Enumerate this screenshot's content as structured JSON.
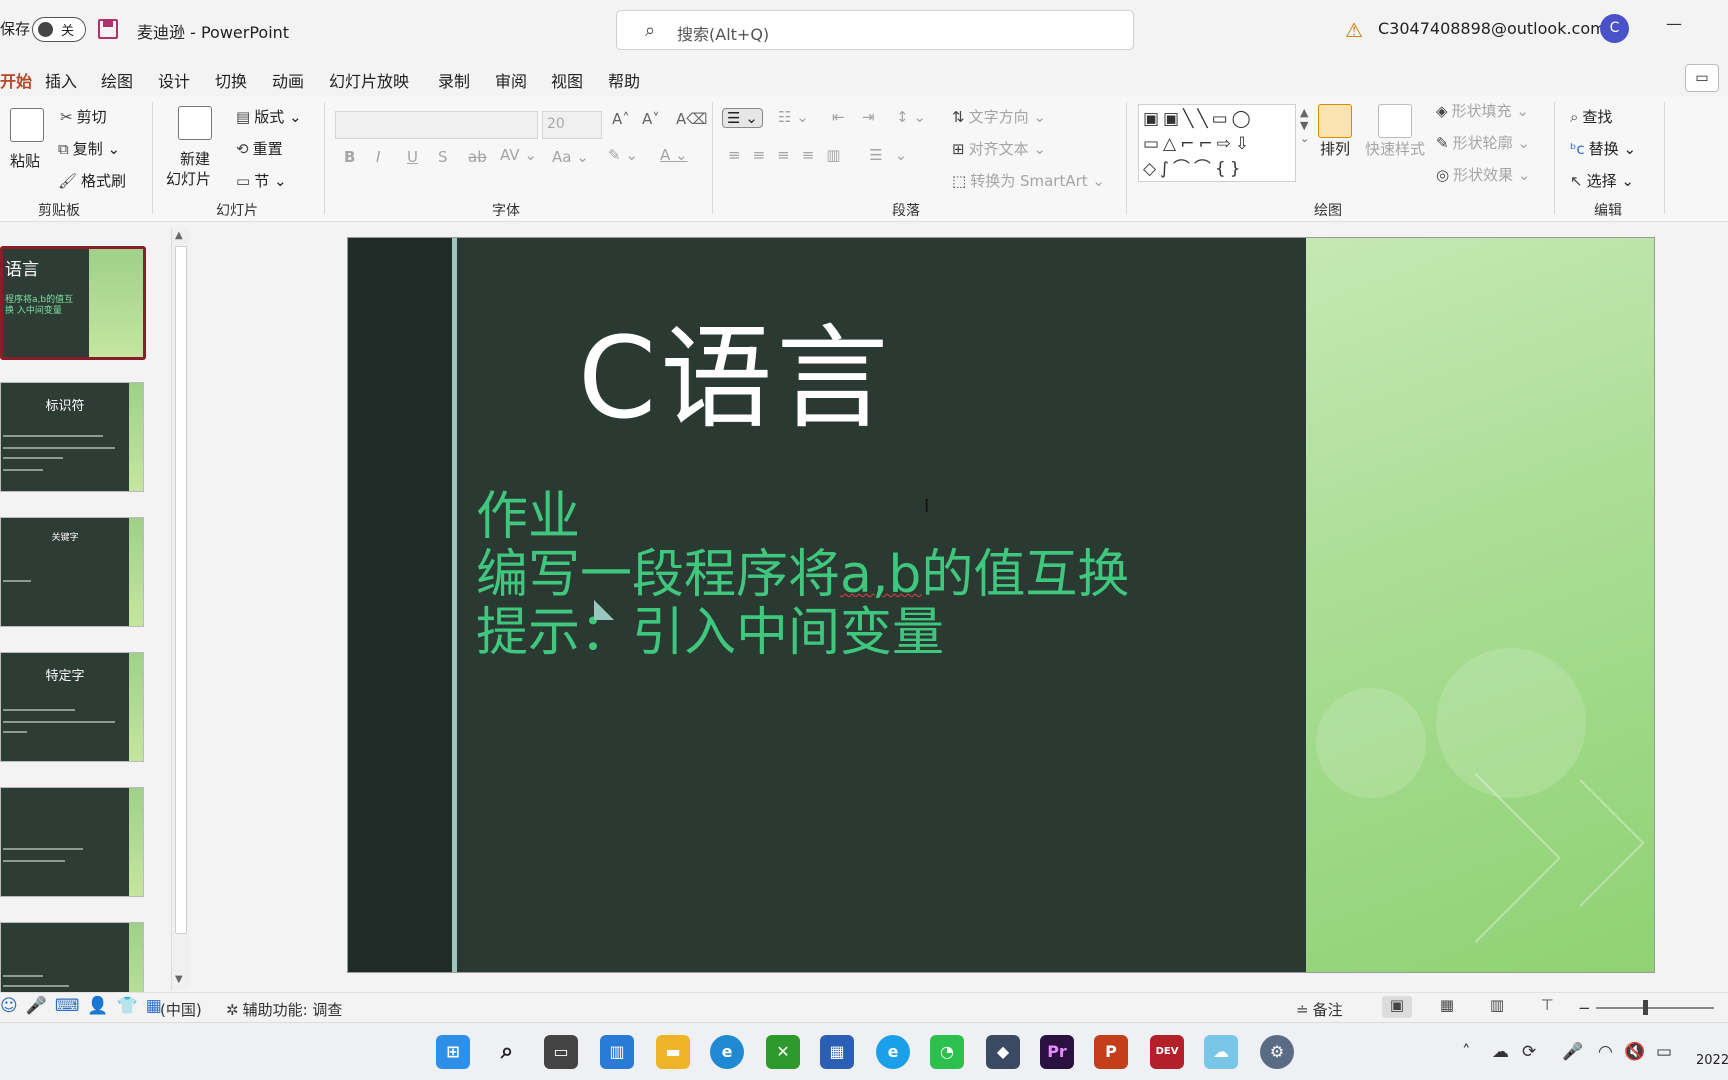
{
  "titlebar": {
    "autosave_label": "保存",
    "toggle_state": "关",
    "doc_title": "麦迪逊  -  PowerPoint",
    "search_placeholder": "搜索(Alt+Q)",
    "account": "C3047408898@outlook.com",
    "avatar_letter": "C"
  },
  "tabs": [
    "开始",
    "插入",
    "绘图",
    "设计",
    "切换",
    "动画",
    "幻灯片放映",
    "录制",
    "审阅",
    "视图",
    "帮助"
  ],
  "ribbon": {
    "clipboard": {
      "paste": "粘贴",
      "cut": "剪切",
      "copy": "复制",
      "format_painter": "格式刷",
      "label": "剪贴板"
    },
    "slides": {
      "new_slide_1": "新建",
      "new_slide_2": "幻灯片",
      "layout": "版式",
      "reset": "重置",
      "section": "节",
      "label": "幻灯片"
    },
    "font": {
      "size": "20",
      "label": "字体"
    },
    "paragraph": {
      "text_direction": "文字方向",
      "align_text": "对齐文本",
      "smartart": "转换为 SmartArt",
      "label": "段落"
    },
    "drawing": {
      "arrange": "排列",
      "quick_styles": "快速样式",
      "shape_fill": "形状填充",
      "shape_outline": "形状轮廓",
      "shape_effects": "形状效果",
      "label": "绘图"
    },
    "editing": {
      "find": "查找",
      "replace": "替换",
      "select": "选择",
      "label": "编辑"
    }
  },
  "thumbnails": [
    {
      "title": "语言",
      "sub": "程序将a,b的值互换 入中间变量",
      "selected": true
    },
    {
      "title": "标识符"
    },
    {
      "title": "关键字"
    },
    {
      "title": "特定字"
    },
    {
      "title": ""
    },
    {
      "title": ""
    }
  ],
  "slide": {
    "title": "C语言",
    "line1": "作业",
    "line2_a": "编写一段程序将",
    "line2_b": "a,b",
    "line2_c": "的值互换",
    "line3": "提示：引入中间变量"
  },
  "status": {
    "language": "(中国)",
    "accessibility": "辅助功能: 调查",
    "notes": "备注"
  },
  "taskbar": {
    "clock": "2022"
  },
  "colors": {
    "accent": "#b7472a",
    "slide_bg": "#2b3933",
    "body_text": "#3fc77e"
  }
}
